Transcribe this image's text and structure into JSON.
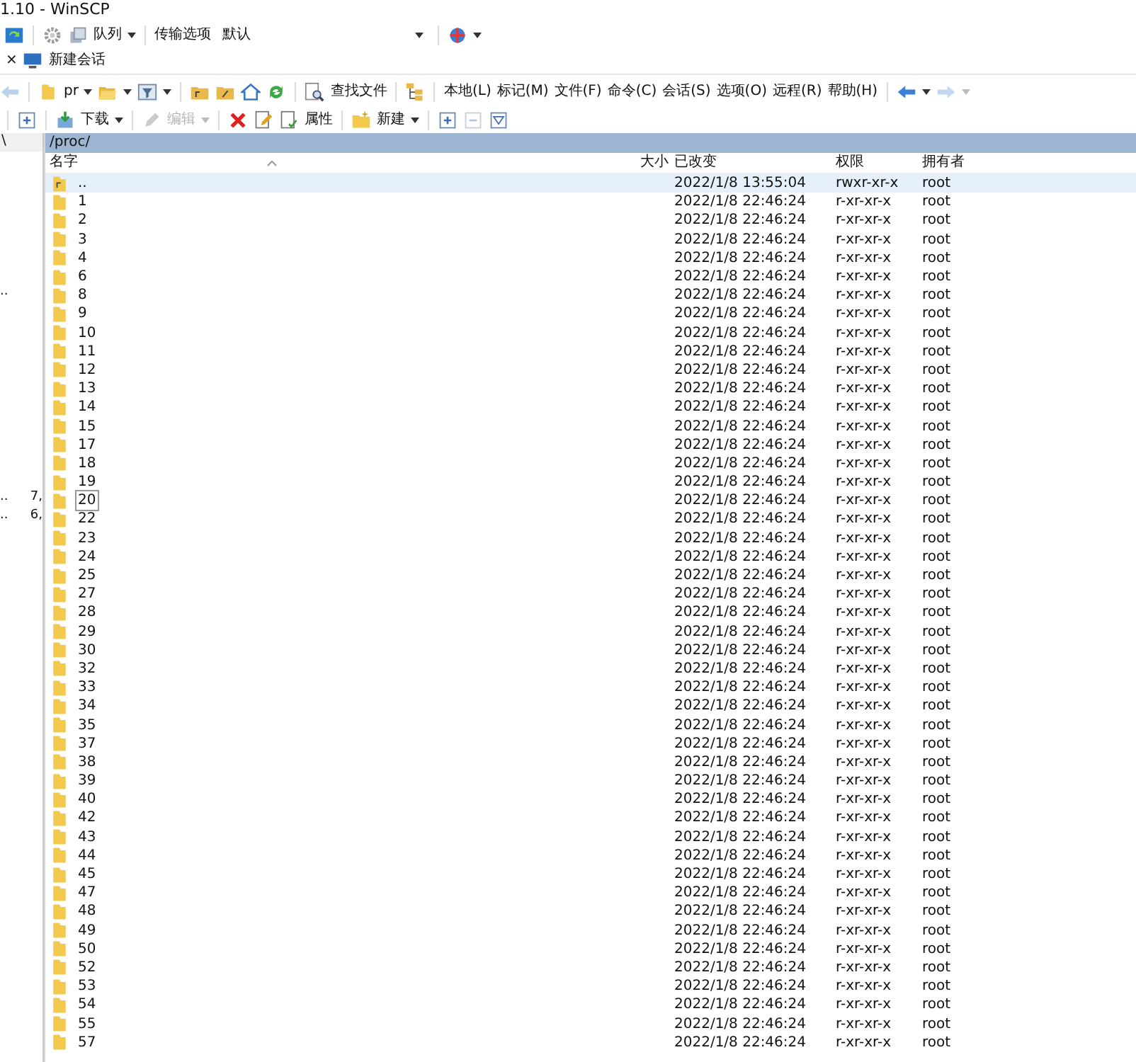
{
  "window": {
    "title": "1.10 - WinSCP"
  },
  "toolbar": {
    "queue_label": "队列",
    "transfer_label": "传输选项",
    "transfer_value": "默认"
  },
  "session_tab": {
    "close": "×",
    "label": "新建会话"
  },
  "nav_toolbar": {
    "path_label": "pr",
    "find_label": "查找文件",
    "back_disabled": false,
    "forward_disabled": true
  },
  "menu": [
    "本地(L)",
    "标记(M)",
    "文件(F)",
    "命令(C)",
    "会话(S)",
    "选项(O)",
    "远程(R)",
    "帮助(H)"
  ],
  "action_toolbar": {
    "buttons": [
      {
        "label": "下载",
        "disabled": false
      },
      {
        "label": "编辑",
        "disabled": true
      }
    ],
    "properties_label": "属性",
    "new_label": "新建",
    "collapse_disabled": true
  },
  "left_pane": {
    "path": "\\",
    "items": [
      {
        "name": ".."
      },
      {
        "name": "..",
        "size": "7,"
      },
      {
        "name": "..",
        "size": "6,"
      }
    ]
  },
  "remote_pane": {
    "path": "/proc/",
    "columns": [
      "名字",
      "大小",
      "已改变",
      "权限",
      "拥有者"
    ],
    "rows": [
      {
        "name": "..",
        "kind": "parent",
        "size": "",
        "modified": "2022/1/8 13:55:04",
        "rights": "rwxr-xr-x",
        "owner": "root",
        "selected": true,
        "focused": false
      },
      {
        "name": "1",
        "kind": "folder",
        "modified": "2022/1/8 22:46:24",
        "rights": "r-xr-xr-x",
        "owner": "root",
        "selected": false,
        "focused": false
      },
      {
        "name": "2",
        "kind": "folder",
        "modified": "2022/1/8 22:46:24",
        "rights": "r-xr-xr-x",
        "owner": "root",
        "selected": false,
        "focused": false
      },
      {
        "name": "3",
        "kind": "folder",
        "modified": "2022/1/8 22:46:24",
        "rights": "r-xr-xr-x",
        "owner": "root",
        "selected": false,
        "focused": false
      },
      {
        "name": "4",
        "kind": "folder",
        "modified": "2022/1/8 22:46:24",
        "rights": "r-xr-xr-x",
        "owner": "root",
        "selected": false,
        "focused": false
      },
      {
        "name": "6",
        "kind": "folder",
        "modified": "2022/1/8 22:46:24",
        "rights": "r-xr-xr-x",
        "owner": "root",
        "selected": false,
        "focused": false
      },
      {
        "name": "8",
        "kind": "folder",
        "modified": "2022/1/8 22:46:24",
        "rights": "r-xr-xr-x",
        "owner": "root",
        "selected": false,
        "focused": false
      },
      {
        "name": "9",
        "kind": "folder",
        "modified": "2022/1/8 22:46:24",
        "rights": "r-xr-xr-x",
        "owner": "root",
        "selected": false,
        "focused": false
      },
      {
        "name": "10",
        "kind": "folder",
        "modified": "2022/1/8 22:46:24",
        "rights": "r-xr-xr-x",
        "owner": "root",
        "selected": false,
        "focused": false
      },
      {
        "name": "11",
        "kind": "folder",
        "modified": "2022/1/8 22:46:24",
        "rights": "r-xr-xr-x",
        "owner": "root",
        "selected": false,
        "focused": false
      },
      {
        "name": "12",
        "kind": "folder",
        "modified": "2022/1/8 22:46:24",
        "rights": "r-xr-xr-x",
        "owner": "root",
        "selected": false,
        "focused": false
      },
      {
        "name": "13",
        "kind": "folder",
        "modified": "2022/1/8 22:46:24",
        "rights": "r-xr-xr-x",
        "owner": "root",
        "selected": false,
        "focused": false
      },
      {
        "name": "14",
        "kind": "folder",
        "modified": "2022/1/8 22:46:24",
        "rights": "r-xr-xr-x",
        "owner": "root",
        "selected": false,
        "focused": false
      },
      {
        "name": "15",
        "kind": "folder",
        "modified": "2022/1/8 22:46:24",
        "rights": "r-xr-xr-x",
        "owner": "root",
        "selected": false,
        "focused": false
      },
      {
        "name": "17",
        "kind": "folder",
        "modified": "2022/1/8 22:46:24",
        "rights": "r-xr-xr-x",
        "owner": "root",
        "selected": false,
        "focused": false
      },
      {
        "name": "18",
        "kind": "folder",
        "modified": "2022/1/8 22:46:24",
        "rights": "r-xr-xr-x",
        "owner": "root",
        "selected": false,
        "focused": false
      },
      {
        "name": "19",
        "kind": "folder",
        "modified": "2022/1/8 22:46:24",
        "rights": "r-xr-xr-x",
        "owner": "root",
        "selected": false,
        "focused": false
      },
      {
        "name": "20",
        "kind": "folder",
        "modified": "2022/1/8 22:46:24",
        "rights": "r-xr-xr-x",
        "owner": "root",
        "selected": false,
        "focused": true
      },
      {
        "name": "22",
        "kind": "folder",
        "modified": "2022/1/8 22:46:24",
        "rights": "r-xr-xr-x",
        "owner": "root",
        "selected": false,
        "focused": false
      },
      {
        "name": "23",
        "kind": "folder",
        "modified": "2022/1/8 22:46:24",
        "rights": "r-xr-xr-x",
        "owner": "root",
        "selected": false,
        "focused": false
      },
      {
        "name": "24",
        "kind": "folder",
        "modified": "2022/1/8 22:46:24",
        "rights": "r-xr-xr-x",
        "owner": "root",
        "selected": false,
        "focused": false
      },
      {
        "name": "25",
        "kind": "folder",
        "modified": "2022/1/8 22:46:24",
        "rights": "r-xr-xr-x",
        "owner": "root",
        "selected": false,
        "focused": false
      },
      {
        "name": "27",
        "kind": "folder",
        "modified": "2022/1/8 22:46:24",
        "rights": "r-xr-xr-x",
        "owner": "root",
        "selected": false,
        "focused": false
      },
      {
        "name": "28",
        "kind": "folder",
        "modified": "2022/1/8 22:46:24",
        "rights": "r-xr-xr-x",
        "owner": "root",
        "selected": false,
        "focused": false
      },
      {
        "name": "29",
        "kind": "folder",
        "modified": "2022/1/8 22:46:24",
        "rights": "r-xr-xr-x",
        "owner": "root",
        "selected": false,
        "focused": false
      },
      {
        "name": "30",
        "kind": "folder",
        "modified": "2022/1/8 22:46:24",
        "rights": "r-xr-xr-x",
        "owner": "root",
        "selected": false,
        "focused": false
      },
      {
        "name": "32",
        "kind": "folder",
        "modified": "2022/1/8 22:46:24",
        "rights": "r-xr-xr-x",
        "owner": "root",
        "selected": false,
        "focused": false
      },
      {
        "name": "33",
        "kind": "folder",
        "modified": "2022/1/8 22:46:24",
        "rights": "r-xr-xr-x",
        "owner": "root",
        "selected": false,
        "focused": false
      },
      {
        "name": "34",
        "kind": "folder",
        "modified": "2022/1/8 22:46:24",
        "rights": "r-xr-xr-x",
        "owner": "root",
        "selected": false,
        "focused": false
      },
      {
        "name": "35",
        "kind": "folder",
        "modified": "2022/1/8 22:46:24",
        "rights": "r-xr-xr-x",
        "owner": "root",
        "selected": false,
        "focused": false
      },
      {
        "name": "37",
        "kind": "folder",
        "modified": "2022/1/8 22:46:24",
        "rights": "r-xr-xr-x",
        "owner": "root",
        "selected": false,
        "focused": false
      },
      {
        "name": "38",
        "kind": "folder",
        "modified": "2022/1/8 22:46:24",
        "rights": "r-xr-xr-x",
        "owner": "root",
        "selected": false,
        "focused": false
      },
      {
        "name": "39",
        "kind": "folder",
        "modified": "2022/1/8 22:46:24",
        "rights": "r-xr-xr-x",
        "owner": "root",
        "selected": false,
        "focused": false
      },
      {
        "name": "40",
        "kind": "folder",
        "modified": "2022/1/8 22:46:24",
        "rights": "r-xr-xr-x",
        "owner": "root",
        "selected": false,
        "focused": false
      },
      {
        "name": "42",
        "kind": "folder",
        "modified": "2022/1/8 22:46:24",
        "rights": "r-xr-xr-x",
        "owner": "root",
        "selected": false,
        "focused": false
      },
      {
        "name": "43",
        "kind": "folder",
        "modified": "2022/1/8 22:46:24",
        "rights": "r-xr-xr-x",
        "owner": "root",
        "selected": false,
        "focused": false
      },
      {
        "name": "44",
        "kind": "folder",
        "modified": "2022/1/8 22:46:24",
        "rights": "r-xr-xr-x",
        "owner": "root",
        "selected": false,
        "focused": false
      },
      {
        "name": "45",
        "kind": "folder",
        "modified": "2022/1/8 22:46:24",
        "rights": "r-xr-xr-x",
        "owner": "root",
        "selected": false,
        "focused": false
      },
      {
        "name": "47",
        "kind": "folder",
        "modified": "2022/1/8 22:46:24",
        "rights": "r-xr-xr-x",
        "owner": "root",
        "selected": false,
        "focused": false
      },
      {
        "name": "48",
        "kind": "folder",
        "modified": "2022/1/8 22:46:24",
        "rights": "r-xr-xr-x",
        "owner": "root",
        "selected": false,
        "focused": false
      },
      {
        "name": "49",
        "kind": "folder",
        "modified": "2022/1/8 22:46:24",
        "rights": "r-xr-xr-x",
        "owner": "root",
        "selected": false,
        "focused": false
      },
      {
        "name": "50",
        "kind": "folder",
        "modified": "2022/1/8 22:46:24",
        "rights": "r-xr-xr-x",
        "owner": "root",
        "selected": false,
        "focused": false
      },
      {
        "name": "52",
        "kind": "folder",
        "modified": "2022/1/8 22:46:24",
        "rights": "r-xr-xr-x",
        "owner": "root",
        "selected": false,
        "focused": false
      },
      {
        "name": "53",
        "kind": "folder",
        "modified": "2022/1/8 22:46:24",
        "rights": "r-xr-xr-x",
        "owner": "root",
        "selected": false,
        "focused": false
      },
      {
        "name": "54",
        "kind": "folder",
        "modified": "2022/1/8 22:46:24",
        "rights": "r-xr-xr-x",
        "owner": "root",
        "selected": false,
        "focused": false
      },
      {
        "name": "55",
        "kind": "folder",
        "modified": "2022/1/8 22:46:24",
        "rights": "r-xr-xr-x",
        "owner": "root",
        "selected": false,
        "focused": false
      },
      {
        "name": "57",
        "kind": "folder",
        "modified": "2022/1/8 22:46:24",
        "rights": "r-xr-xr-x",
        "owner": "root",
        "selected": false,
        "focused": false
      }
    ]
  }
}
